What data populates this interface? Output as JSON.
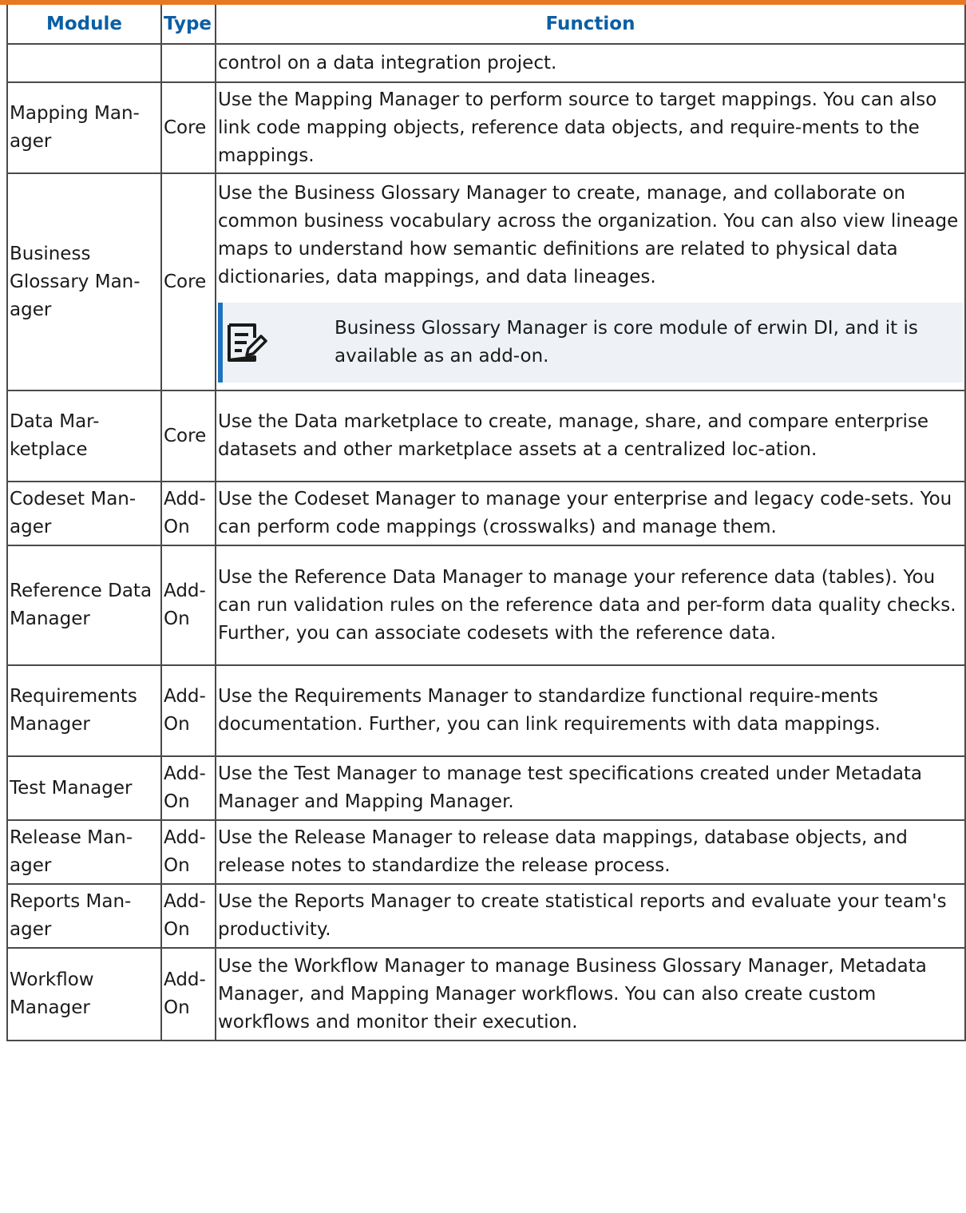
{
  "columns": {
    "module": "Module",
    "type": "Type",
    "function": "Function"
  },
  "rows": [
    {
      "module": "",
      "type": "",
      "function": "control on a data integration project."
    },
    {
      "module": "Mapping Man-ager",
      "type": "Core",
      "function": "Use the Mapping Manager to perform source to target mappings. You can also link code mapping objects, reference data objects, and require-ments to the mappings."
    },
    {
      "module": "Business Glossary Man-ager",
      "type": "Core",
      "function": "Use the Business Glossary Manager to create, manage, and collaborate on common business vocabulary across the organization. You can also view lineage maps to understand how semantic definitions are related to physical data dictionaries, data mappings, and data lineages.",
      "note": "Business Glossary Manager is core module of erwin DI, and it is available as an add-on."
    },
    {
      "module": "Data Mar-ketplace",
      "type": "Core",
      "function": "Use the Data marketplace to create, manage, share, and compare enterprise datasets and other marketplace assets at a centralized loc-ation."
    },
    {
      "module": "Codeset Man-ager",
      "type": "Add-On",
      "function": "Use the Codeset Manager to manage your enterprise and legacy code-sets. You can perform code mappings (crosswalks) and manage them."
    },
    {
      "module": "Reference Data Manager",
      "type": "Add-On",
      "function": "Use the Reference Data Manager to manage your reference data (tables). You can run validation rules on the reference data and per-form data quality checks. Further, you can associate codesets with the reference data."
    },
    {
      "module": "Requirements Manager",
      "type": "Add-On",
      "function": "Use the Requirements Manager to standardize functional require-ments documentation. Further, you can link requirements with data mappings."
    },
    {
      "module": "Test Manager",
      "type": "Add-On",
      "function": "Use the Test Manager to manage test specifications created under Metadata Manager and Mapping Manager."
    },
    {
      "module": "Release Man-ager",
      "type": "Add-On",
      "function": "Use the Release Manager to release data mappings, database objects, and release notes to standardize the release process."
    },
    {
      "module": "Reports Man-ager",
      "type": "Add-On",
      "function": "Use the Reports Manager to create statistical reports and evaluate your team's productivity."
    },
    {
      "module": "Workflow Manager",
      "type": "Add-On",
      "function": "Use the Workflow Manager to manage Business Glossary Manager, Metadata Manager, and Mapping Manager workflows. You can also create custom workflows and monitor their execution."
    }
  ],
  "icons": {
    "note": "note-edit-icon"
  },
  "colors": {
    "header_text": "#0a5fa5",
    "accent_bar": "#e87722",
    "note_bg": "#eef2f6",
    "note_border": "#1e73be"
  }
}
